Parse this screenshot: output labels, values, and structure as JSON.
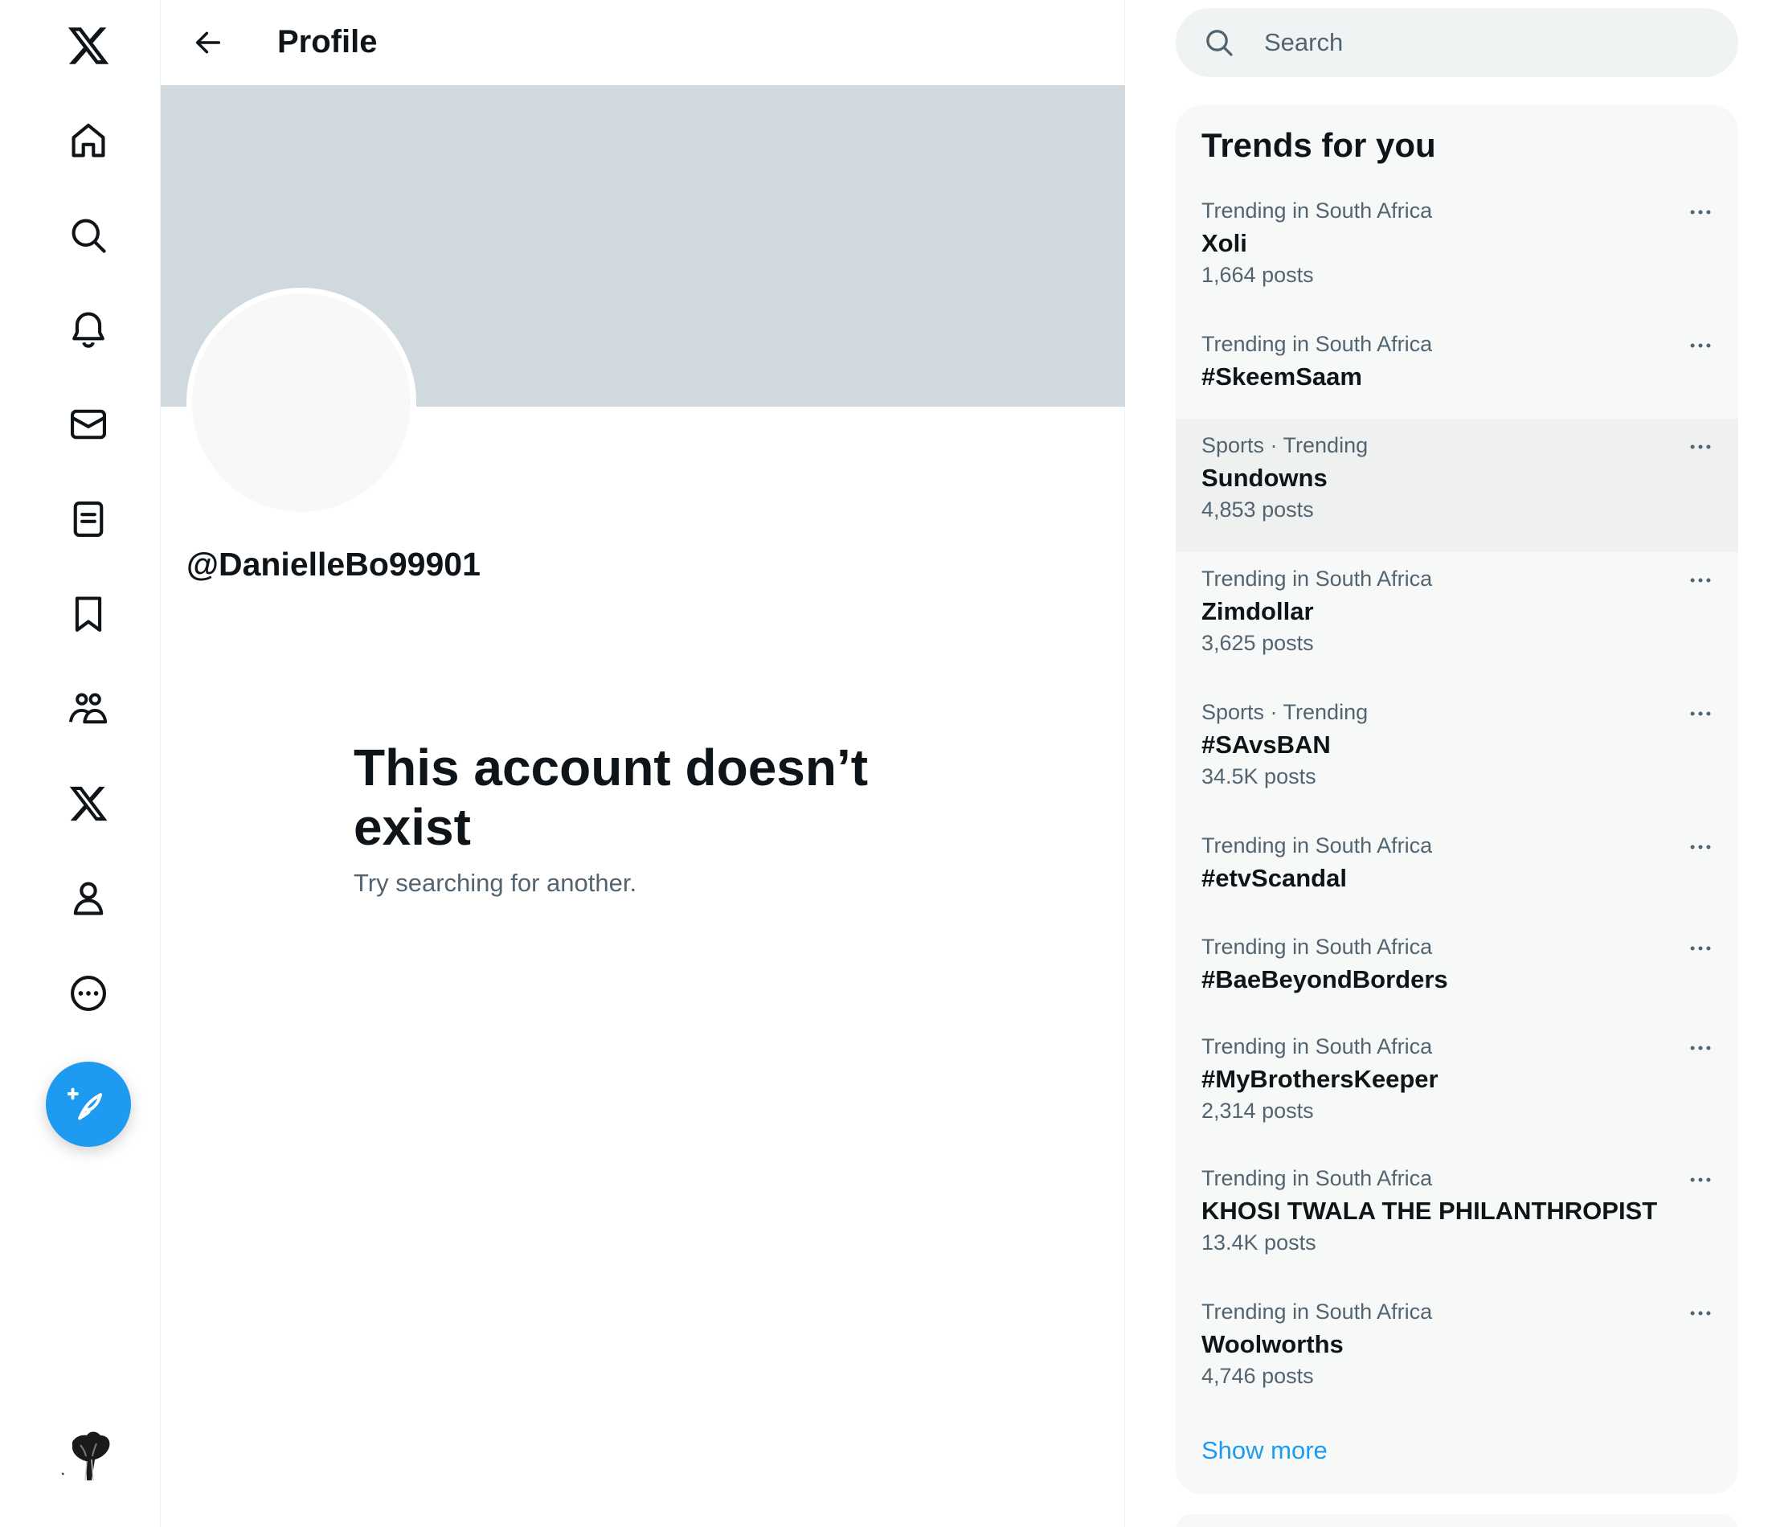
{
  "nav": {
    "items": [
      {
        "icon": "x-logo-icon"
      },
      {
        "icon": "home-icon"
      },
      {
        "icon": "search-icon"
      },
      {
        "icon": "bell-icon"
      },
      {
        "icon": "mail-icon"
      },
      {
        "icon": "lists-icon"
      },
      {
        "icon": "bookmark-icon"
      },
      {
        "icon": "communities-icon"
      },
      {
        "icon": "x-premium-icon"
      },
      {
        "icon": "profile-icon"
      },
      {
        "icon": "more-circle-icon"
      }
    ],
    "compose_icon": "feather-plus-icon",
    "compose_color": "#1d9bf0"
  },
  "header": {
    "title": "Profile",
    "back_icon": "arrow-left-icon"
  },
  "profile": {
    "handle": "@DanielleBo99901",
    "banner_color": "#cfd9de"
  },
  "empty_state": {
    "title": "This account doesn’t exist",
    "subtitle": "Try searching for another."
  },
  "search": {
    "placeholder": "Search",
    "icon": "search-icon"
  },
  "trends": {
    "title": "Trends for you",
    "items": [
      {
        "context": "Trending in South Africa",
        "name": "Xoli",
        "posts": "1,664 posts"
      },
      {
        "context": "Trending in South Africa",
        "name": "#SkeemSaam",
        "posts": ""
      },
      {
        "context": "Sports · Trending",
        "name": "Sundowns",
        "posts": "4,853 posts"
      },
      {
        "context": "Trending in South Africa",
        "name": "Zimdollar",
        "posts": "3,625 posts"
      },
      {
        "context": "Sports · Trending",
        "name": "#SAvsBAN",
        "posts": "34.5K posts"
      },
      {
        "context": "Trending in South Africa",
        "name": "#etvScandal",
        "posts": ""
      },
      {
        "context": "Trending in South Africa",
        "name": "#BaeBeyondBorders",
        "posts": ""
      },
      {
        "context": "Trending in South Africa",
        "name": "#MyBrothersKeeper",
        "posts": "2,314 posts"
      },
      {
        "context": "Trending in South Africa",
        "name": "KHOSI TWALA THE PHILANTHROPIST",
        "posts": "13.4K posts"
      },
      {
        "context": "Trending in South Africa",
        "name": "Woolworths",
        "posts": "4,746 posts"
      }
    ],
    "show_more": "Show more",
    "accent_color": "#1d9bf0"
  }
}
